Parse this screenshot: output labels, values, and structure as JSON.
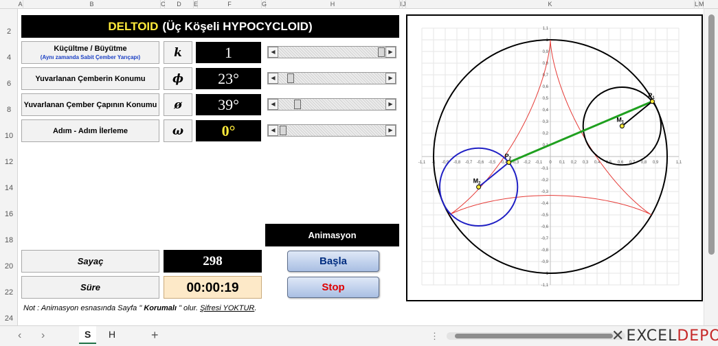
{
  "columns": [
    "A",
    "B",
    "C",
    "D",
    "E",
    "F",
    "G",
    "H",
    "I",
    "J",
    "K",
    "L",
    "M"
  ],
  "rows": [
    "2",
    "4",
    "6",
    "8",
    "10",
    "12",
    "14",
    "16",
    "18",
    "20",
    "22",
    "24"
  ],
  "title": {
    "main": "DELTOID",
    "sub": "(Üç Köşeli HYPOCYCLOID)"
  },
  "params": [
    {
      "label": "Küçültme / Büyütme",
      "sublabel": "(Aynı zamanda Sabit Çember Yarıçapı)",
      "symbol": "k",
      "value": "1",
      "slider_fraction": 1.0
    },
    {
      "label": "Yuvarlanan Çemberin Konumu",
      "sublabel": "",
      "symbol": "ϕ",
      "value": "23°",
      "slider_fraction": 0.08
    },
    {
      "label": "Yuvarlanan Çember Çapının Konumu",
      "sublabel": "",
      "symbol": "ø",
      "value": "39°",
      "slider_fraction": 0.15
    },
    {
      "label": "Adım - Adım İlerleme",
      "sublabel": "",
      "symbol": "ω",
      "value": "0°",
      "slider_fraction": 0.0
    }
  ],
  "animation": {
    "header": "Animasyon",
    "start_label": "Başla",
    "stop_label": "Stop"
  },
  "counter": {
    "label": "Sayaç",
    "value": "298"
  },
  "duration": {
    "label": "Süre",
    "value": "00:00:19"
  },
  "note": {
    "prefix": "Not : Animasyon esnasında Sayfa \"",
    "bold": " Korumalı ",
    "middle": "\" olur. ",
    "underline": "Şifresi YOKTUR",
    "suffix": "."
  },
  "sheet_tabs": [
    "S",
    "H"
  ],
  "active_tab": "S",
  "brand": {
    "part1": "EXCEL",
    "part2": "DEPO"
  },
  "chart_data": {
    "type": "scatter",
    "xlim": [
      -1.1,
      1.1
    ],
    "ylim": [
      -1.1,
      1.1
    ],
    "x_ticks": [
      "-1,1",
      "-1",
      "-0,9",
      "-0,8",
      "-0,7",
      "-0,6",
      "-0,5",
      "-0,4",
      "-0,3",
      "-0,2",
      "-0,1",
      "0",
      "0,1",
      "0,2",
      "0,3",
      "0,4",
      "0,5",
      "0,6",
      "0,7",
      "0,8",
      "0,9",
      "1",
      "1,1"
    ],
    "y_ticks": [
      "1,1",
      "1",
      "0,9",
      "0,8",
      "0,7",
      "0,6",
      "0,5",
      "0,4",
      "0,3",
      "0,2",
      "0,1",
      "0",
      "-0,1",
      "-0,2",
      "-0,3",
      "-0,4",
      "-0,5",
      "-0,6",
      "-0,7",
      "-0,8",
      "-0,9",
      "-1",
      "-1,1"
    ],
    "grid": true,
    "fixed_circle": {
      "cx": 0,
      "cy": 0,
      "r": 1,
      "color": "#000000"
    },
    "deltoid": {
      "r": 0.3333,
      "color": "#e53935"
    },
    "rolling_circles": [
      {
        "label": "M1",
        "cx": 0.614,
        "cy": 0.261,
        "r": 0.3333,
        "color": "#000000"
      },
      {
        "label": "M2",
        "cx": -0.614,
        "cy": -0.261,
        "r": 0.3333,
        "color": "#1f1fc4"
      }
    ],
    "points": [
      {
        "label": "P1",
        "x": 0.873,
        "y": 0.472
      },
      {
        "label": "P2",
        "x": -0.355,
        "y": -0.05
      }
    ],
    "diameter_line": {
      "from": "P2",
      "to": "P1",
      "color": "#1fa01f"
    },
    "radius_segments": [
      {
        "from": "M1",
        "to": "P1",
        "color": "#000000"
      },
      {
        "from": "M2",
        "to": "P2",
        "color": "#1f1fc4"
      }
    ]
  }
}
